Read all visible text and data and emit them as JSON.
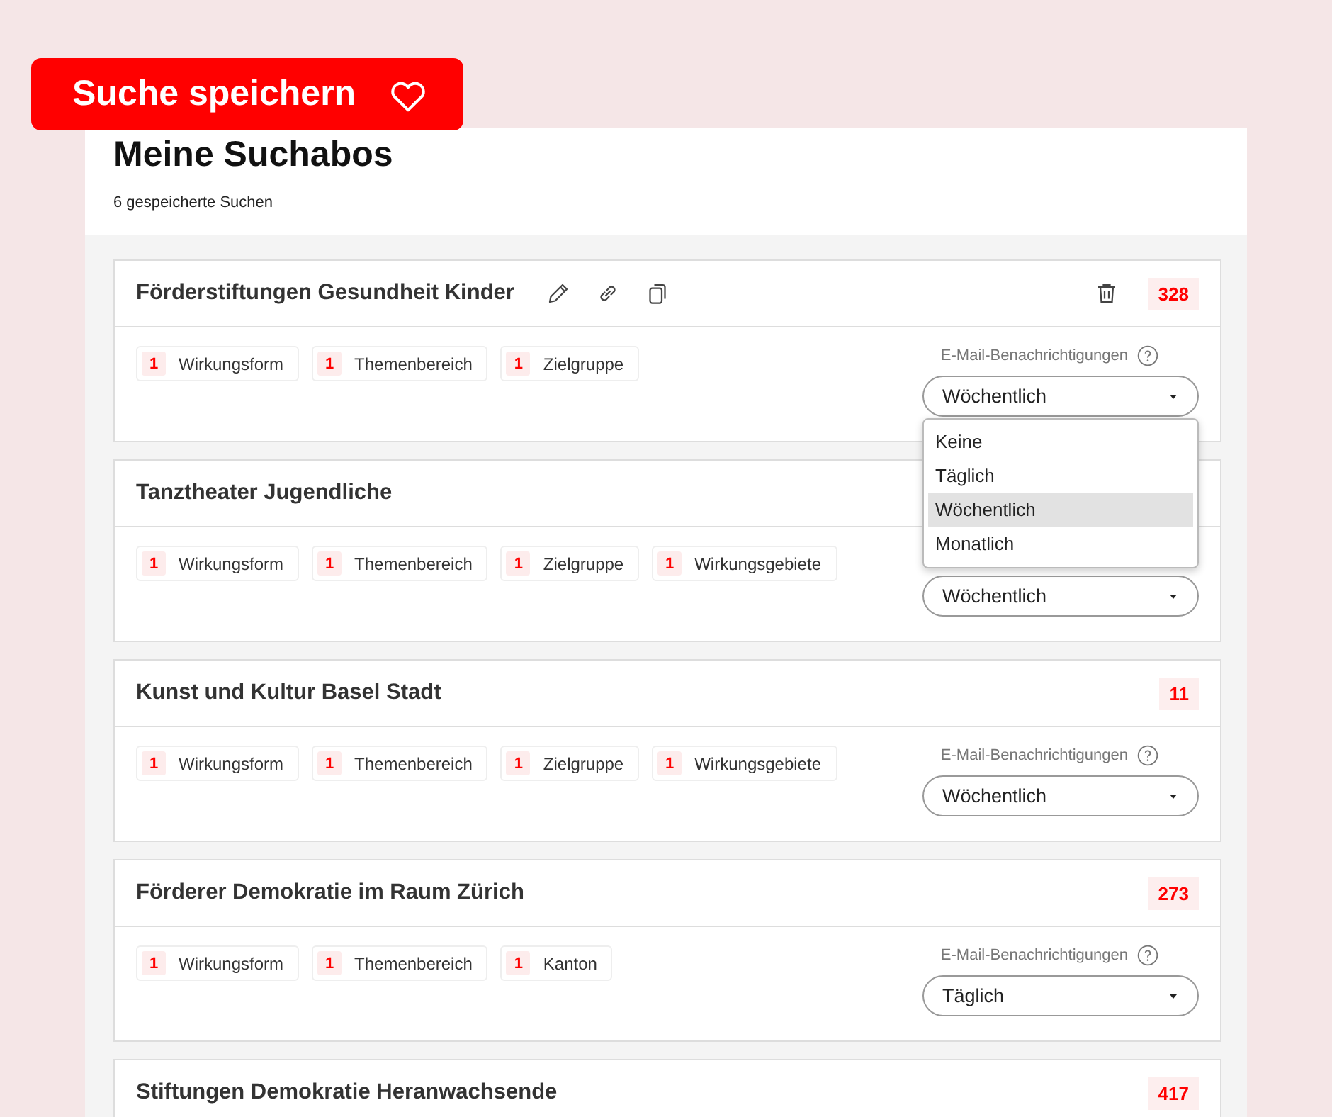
{
  "save_button": {
    "label": "Suche speichern"
  },
  "title": "Meine Suchabos",
  "subtitle": "6 gespeicherte Suchen",
  "searches": [
    {
      "name": "Förderstiftungen Gesundheit Kinder",
      "show_actions": true,
      "count": "328",
      "filters": [
        {
          "count": "1",
          "label": "Wirkungsform"
        },
        {
          "count": "1",
          "label": "Themenbereich"
        },
        {
          "count": "1",
          "label": "Zielgruppe"
        }
      ],
      "notification_label": "E-Mail-Benachrichtigungen",
      "notification_value": "Wöchentlich",
      "menu": {
        "options": [
          {
            "label": "Keine",
            "selected": false
          },
          {
            "label": "Täglich",
            "selected": false
          },
          {
            "label": "Wöchentlich",
            "selected": true
          },
          {
            "label": "Monatlich",
            "selected": false
          }
        ]
      }
    },
    {
      "name": "Tanztheater Jugendliche",
      "show_actions": false,
      "filters": [
        {
          "count": "1",
          "label": "Wirkungsform"
        },
        {
          "count": "1",
          "label": "Themenbereich"
        },
        {
          "count": "1",
          "label": "Zielgruppe"
        },
        {
          "count": "1",
          "label": "Wirkungsgebiete"
        }
      ],
      "notification_value": "Wöchentlich"
    },
    {
      "name": "Kunst und Kultur Basel Stadt",
      "show_actions": false,
      "count": "11",
      "filters": [
        {
          "count": "1",
          "label": "Wirkungsform"
        },
        {
          "count": "1",
          "label": "Themenbereich"
        },
        {
          "count": "1",
          "label": "Zielgruppe"
        },
        {
          "count": "1",
          "label": "Wirkungsgebiete"
        }
      ],
      "notification_label": "E-Mail-Benachrichtigungen",
      "notification_value": "Wöchentlich"
    },
    {
      "name": "Förderer Demokratie im Raum Zürich",
      "show_actions": false,
      "count": "273",
      "filters": [
        {
          "count": "1",
          "label": "Wirkungsform"
        },
        {
          "count": "1",
          "label": "Themenbereich"
        },
        {
          "count": "1",
          "label": "Kanton"
        }
      ],
      "notification_label": "E-Mail-Benachrichtigungen",
      "notification_value": "Täglich"
    },
    {
      "name": "Stiftungen Demokratie Heranwachsende",
      "show_actions": false,
      "count": "417"
    }
  ]
}
